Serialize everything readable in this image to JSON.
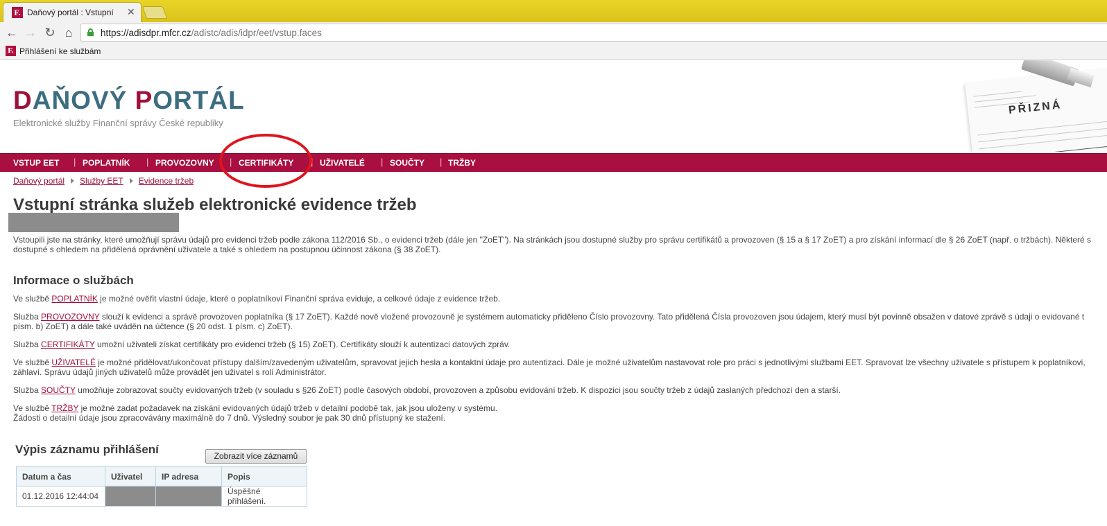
{
  "browser": {
    "tab_title": "Daňový portál : Vstupní",
    "tab_icon_letter": "F.",
    "url_host": "https://adisdpr.mfcr.cz",
    "url_path": "/adistc/adis/idpr/eet/vstup.faces",
    "bookmark_label": "Přihlášení ke službám",
    "bookmark_icon_letter": "F."
  },
  "header": {
    "logo_d": "D",
    "logo_rest1": "AŇOVÝ ",
    "logo_p": "P",
    "logo_rest2": "ORTÁL",
    "tagline": "Elektronické služby Finanční správy České republiky",
    "art_title": "PŘIZNÁ"
  },
  "nav": [
    "VSTUP EET",
    "POPLATNÍK",
    "PROVOZOVNY",
    "CERTIFIKÁTY",
    "UŽIVATELÉ",
    "SOUČTY",
    "TRŽBY"
  ],
  "breadcrumb": [
    "Daňový portál",
    "Služby EET",
    "Evidence tržeb"
  ],
  "page_title": "Vstupní stránka služeb elektronické evidence tržeb",
  "intro": {
    "line1": "Vstoupili jste na stránky, které umožňují správu údajů pro evidenci tržeb podle zákona 112/2016 Sb., o evidenci tržeb (dále jen \"ZoET\"). Na stránkách jsou dostupné služby pro správu certifikátů a provozoven (§ 15 a § 17 ZoET) a pro získání informací dle § 26 ZoET (např. o tržbách). Některé s",
    "line2": "dostupné s ohledem na přidělená oprávnění uživatele a také s ohledem na postupnou účinnost zákona (§ 38 ZoET)."
  },
  "services": {
    "heading": "Informace o službách",
    "poplatnik": {
      "pre": "Ve službě ",
      "link": "POPLATNÍK",
      "post": " je možné ověřit vlastní údaje, které o poplatníkovi Finanční správa eviduje, a celkové údaje z evidence tržeb."
    },
    "provozovny": {
      "pre": "Služba ",
      "link": "PROVOZOVNY",
      "post": " slouží k evidenci a správě provozoven poplatníka (§ 17 ZoET). Každé nově vložené provozovně je systémem automaticky přiděleno Číslo provozovny. Tato přidělená Čísla provozoven jsou údajem, který musí být povinně obsažen v datové zprávě s údaji o evidované t",
      "line2": "písm. b) ZoET) a dále také uváděn na účtence (§ 20 odst. 1 písm. c) ZoET)."
    },
    "certifikaty": {
      "pre": "Služba ",
      "link": "CERTIFIKÁTY",
      "post": " umožní uživateli získat certifikáty pro evidenci tržeb (§ 15) ZoET). Certifikáty slouží k autentizaci datových zpráv."
    },
    "uzivatele": {
      "pre": "Ve službě ",
      "link": "UŽIVATELÉ",
      "post": " je možné přidělovat/ukončovat přístupy dalším/zavedeným uživatelům, spravovat jejich hesla a kontaktní údaje pro autentizaci. Dále je možné uživatelům nastavovat role pro práci s jednotlivými službami EET. Spravovat lze všechny uživatele s přístupem k poplatníkovi,",
      "line2": "záhlaví. Správu údajů jiných uživatelů může provádět jen uživatel s rolí Administrátor."
    },
    "soucty": {
      "pre": "Služba ",
      "link": "SOUČTY",
      "post": " umožňuje zobrazovat součty evidovaných tržeb (v souladu s §26 ZoET) podle časových období, provozoven a způsobu evidování tržeb. K dispozici jsou součty tržeb z údajů zaslaných předchozí den a starší."
    },
    "trzby": {
      "pre": "Ve službě ",
      "link": "TRŽBY",
      "post": " je možné zadat požadavek na získání evidovaných údajů tržeb v detailní podobě tak, jak jsou uloženy v systému.",
      "line2": "Žádosti o detailní údaje jsou zpracovávány maximálně do 7 dnů. Výsledný soubor je pak 30 dnů přístupný ke stažení."
    }
  },
  "login_log": {
    "heading": "Výpis záznamu přihlášení",
    "more_button": "Zobrazit více záznamů",
    "columns": [
      "Datum a čas",
      "Uživatel",
      "IP adresa",
      "Popis"
    ],
    "rows": [
      {
        "datetime": "01.12.2016 12:44:04",
        "description": "Úspěšné přihlášení."
      }
    ]
  },
  "colors": {
    "brand": "#a90f40",
    "logo_blue": "#3c6d80",
    "annotation": "#e0141c"
  }
}
